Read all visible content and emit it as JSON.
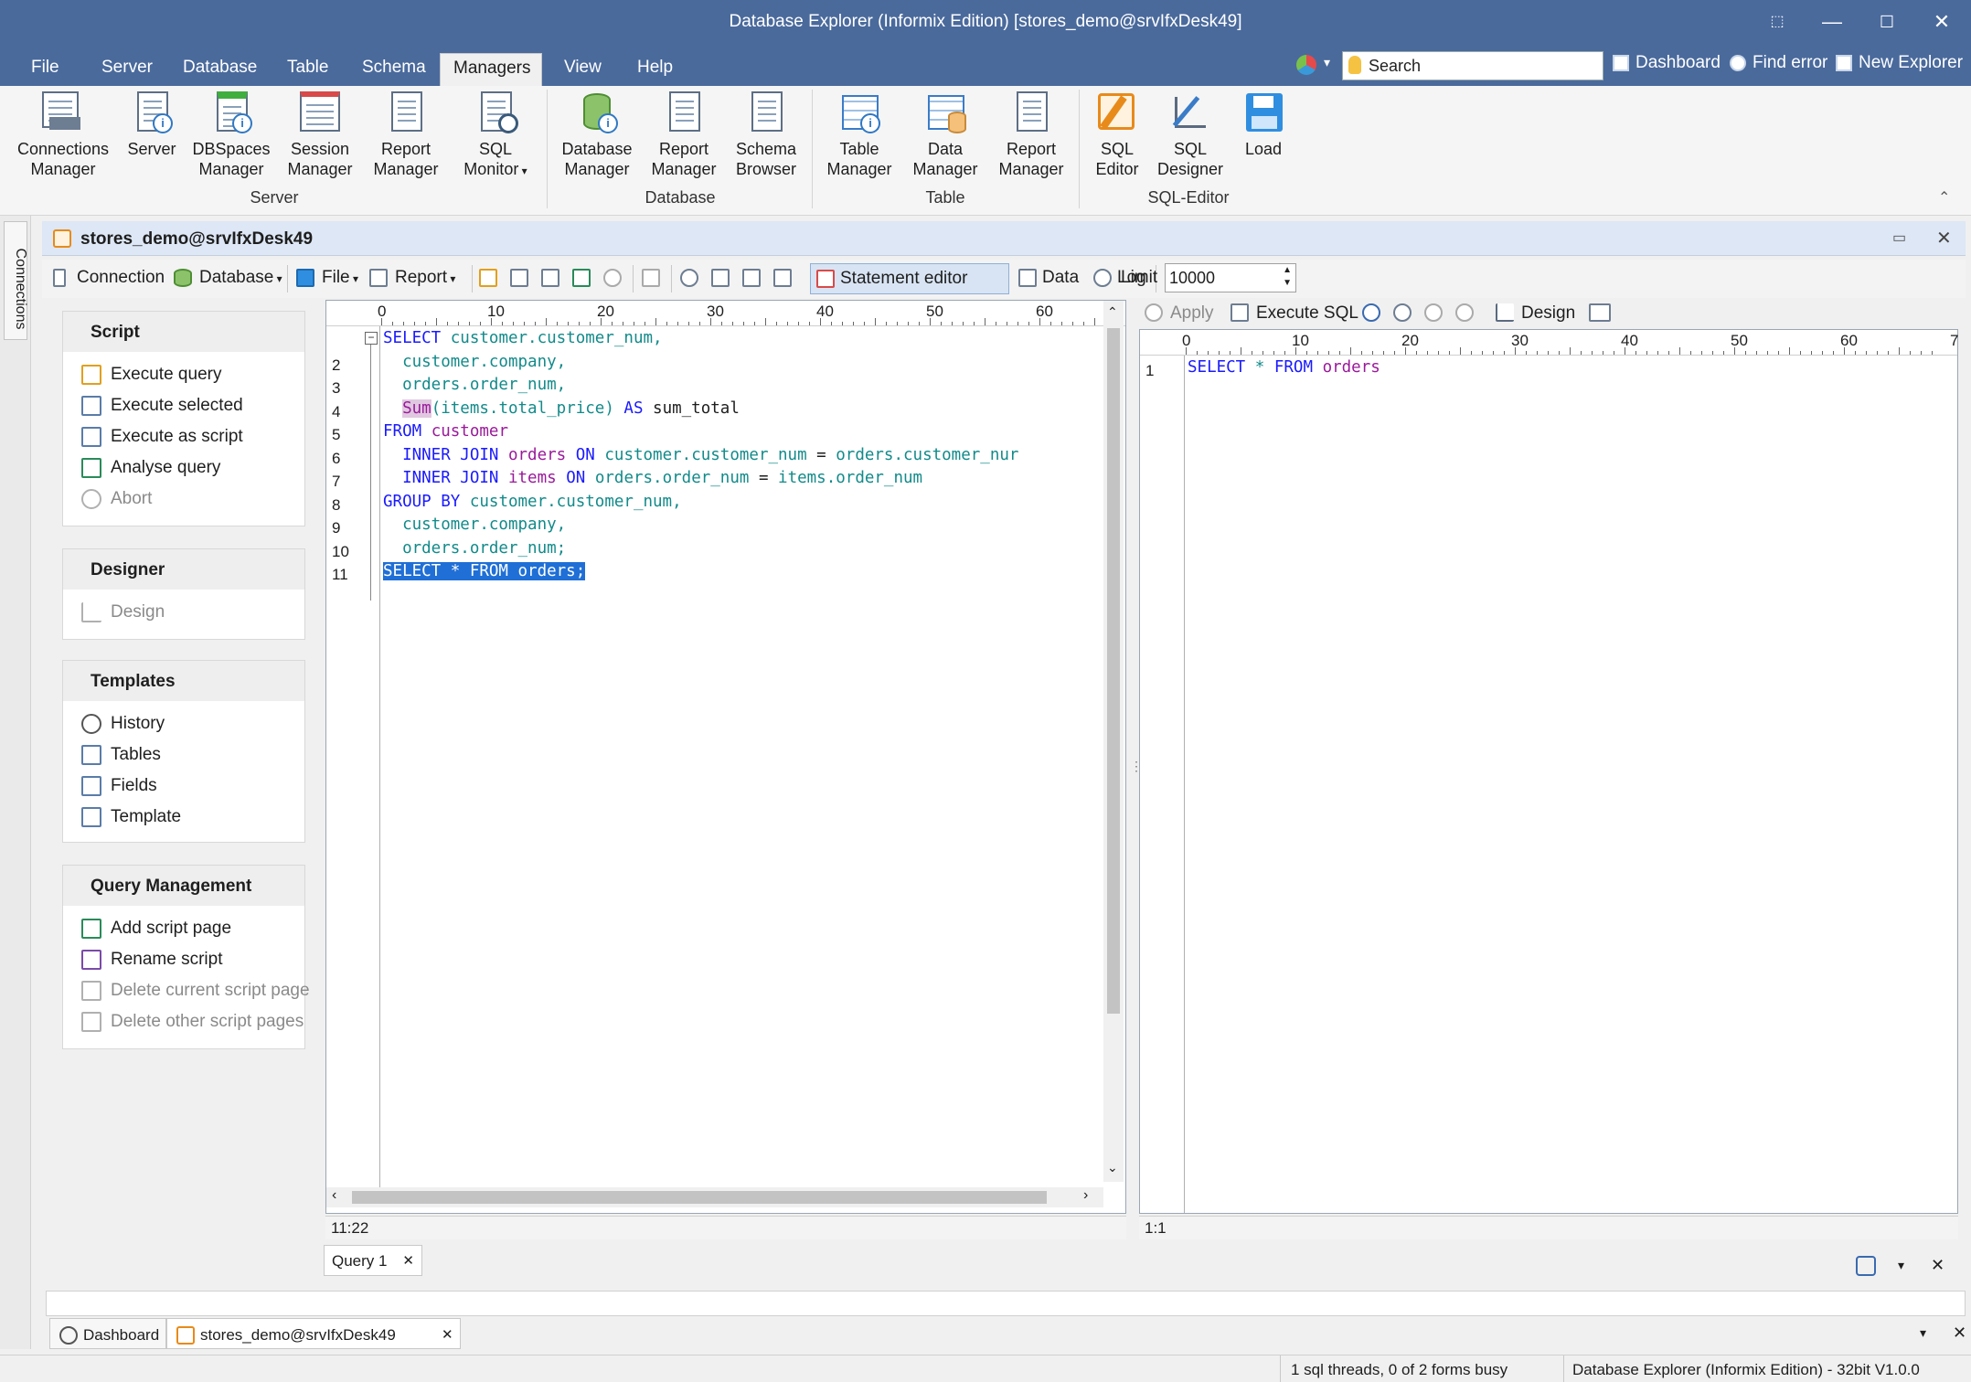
{
  "window": {
    "title": "Database Explorer (Informix Edition) [stores_demo@srvIfxDesk49]"
  },
  "menu": [
    "File",
    "Server",
    "Database",
    "Table",
    "Schema",
    "Managers",
    "View",
    "Help"
  ],
  "search": {
    "placeholder": "Search"
  },
  "quick_links": [
    "Dashboard",
    "Find error",
    "New Explorer"
  ],
  "ribbon": {
    "server": {
      "label": "Server",
      "items": [
        {
          "l1": "Connections",
          "l2": "Manager",
          "icon": "connections-manager-icon"
        },
        {
          "l1": "Server",
          "l2": "",
          "icon": "server-icon"
        },
        {
          "l1": "DBSpaces",
          "l2": "Manager",
          "icon": "dbspaces-manager-icon"
        },
        {
          "l1": "Session",
          "l2": "Manager",
          "icon": "session-manager-icon"
        },
        {
          "l1": "Report",
          "l2": "Manager",
          "icon": "report-manager-icon"
        },
        {
          "l1": "SQL",
          "l2": "Monitor",
          "icon": "sql-monitor-icon"
        }
      ]
    },
    "database": {
      "label": "Database",
      "items": [
        {
          "l1": "Database",
          "l2": "Manager",
          "icon": "database-manager-icon"
        },
        {
          "l1": "Report",
          "l2": "Manager",
          "icon": "report-manager-icon"
        },
        {
          "l1": "Schema",
          "l2": "Browser",
          "icon": "schema-browser-icon"
        }
      ]
    },
    "table": {
      "label": "Table",
      "items": [
        {
          "l1": "Table",
          "l2": "Manager",
          "icon": "table-manager-icon"
        },
        {
          "l1": "Data",
          "l2": "Manager",
          "icon": "data-manager-icon"
        },
        {
          "l1": "Report",
          "l2": "Manager",
          "icon": "report-manager-icon"
        }
      ]
    },
    "sqleditor": {
      "label": "SQL-Editor",
      "items": [
        {
          "l1": "SQL",
          "l2": "Editor",
          "icon": "sql-editor-icon"
        },
        {
          "l1": "SQL",
          "l2": "Designer",
          "icon": "sql-designer-icon"
        },
        {
          "l1": "Load",
          "l2": "",
          "icon": "load-icon"
        }
      ]
    }
  },
  "side_tab": "Connections",
  "document": {
    "title": "stores_demo@srvIfxDesk49"
  },
  "toolbar": {
    "connection": "Connection",
    "database": "Database",
    "file": "File",
    "report": "Report",
    "statement_editor": "Statement editor",
    "data": "Data",
    "log": "Log",
    "limit_label": "Limit",
    "limit_value": "10000"
  },
  "panels": {
    "script": {
      "title": "Script",
      "items": [
        {
          "label": "Execute query",
          "enabled": true
        },
        {
          "label": "Execute selected",
          "enabled": true
        },
        {
          "label": "Execute as script",
          "enabled": true
        },
        {
          "label": "Analyse query",
          "enabled": true
        },
        {
          "label": "Abort",
          "enabled": false
        }
      ]
    },
    "designer": {
      "title": "Designer",
      "items": [
        {
          "label": "Design",
          "enabled": false
        }
      ]
    },
    "templates": {
      "title": "Templates",
      "items": [
        {
          "label": "History",
          "enabled": true
        },
        {
          "label": "Tables",
          "enabled": true
        },
        {
          "label": "Fields",
          "enabled": true
        },
        {
          "label": "Template",
          "enabled": true
        }
      ]
    },
    "query_management": {
      "title": "Query Management",
      "items": [
        {
          "label": "Add script page",
          "enabled": true
        },
        {
          "label": "Rename script",
          "enabled": true
        },
        {
          "label": "Delete current script page",
          "enabled": false
        },
        {
          "label": "Delete other script pages",
          "enabled": false
        }
      ]
    }
  },
  "editor": {
    "ruler": [
      "0",
      "10",
      "20",
      "30",
      "40",
      "50",
      "60"
    ],
    "line_numbers": [
      "",
      "2",
      "3",
      "4",
      "5",
      "6",
      "7",
      "8",
      "9",
      "10",
      "11"
    ],
    "lines": [
      [
        [
          "kw",
          "SELECT"
        ],
        [
          "plain",
          " "
        ],
        [
          "fld",
          "customer.customer_num,"
        ]
      ],
      [
        [
          "plain",
          "  "
        ],
        [
          "fld",
          "customer.company,"
        ]
      ],
      [
        [
          "plain",
          "  "
        ],
        [
          "fld",
          "orders.order_num,"
        ]
      ],
      [
        [
          "plain",
          "  "
        ],
        [
          "fn",
          "Sum"
        ],
        [
          "fld",
          "(items.total_price)"
        ],
        [
          "plain",
          " "
        ],
        [
          "kw",
          "AS"
        ],
        [
          "plain",
          " sum_total"
        ]
      ],
      [
        [
          "kw",
          "FROM"
        ],
        [
          "plain",
          " "
        ],
        [
          "obj",
          "customer"
        ]
      ],
      [
        [
          "plain",
          "  "
        ],
        [
          "kw",
          "INNER JOIN"
        ],
        [
          "plain",
          " "
        ],
        [
          "obj",
          "orders"
        ],
        [
          "plain",
          " "
        ],
        [
          "kw",
          "ON"
        ],
        [
          "plain",
          " "
        ],
        [
          "fld",
          "customer.customer_num"
        ],
        [
          "plain",
          " = "
        ],
        [
          "fld",
          "orders.customer_nur"
        ]
      ],
      [
        [
          "plain",
          "  "
        ],
        [
          "kw",
          "INNER JOIN"
        ],
        [
          "plain",
          " "
        ],
        [
          "obj",
          "items"
        ],
        [
          "plain",
          " "
        ],
        [
          "kw",
          "ON"
        ],
        [
          "plain",
          " "
        ],
        [
          "fld",
          "orders.order_num"
        ],
        [
          "plain",
          " = "
        ],
        [
          "fld",
          "items.order_num"
        ]
      ],
      [
        [
          "kw",
          "GROUP BY"
        ],
        [
          "plain",
          " "
        ],
        [
          "fld",
          "customer.customer_num,"
        ]
      ],
      [
        [
          "plain",
          "  "
        ],
        [
          "fld",
          "customer.company,"
        ]
      ],
      [
        [
          "plain",
          "  "
        ],
        [
          "fld",
          "orders.order_num;"
        ]
      ],
      [
        [
          "sel",
          "SELECT * FROM orders;"
        ]
      ]
    ],
    "status": "11:22"
  },
  "stmt": {
    "toolbar": {
      "apply": "Apply",
      "execute_sql": "Execute SQL",
      "design": "Design"
    },
    "ruler": [
      "0",
      "10",
      "20",
      "30",
      "40",
      "50",
      "60",
      "7"
    ],
    "line_numbers": [
      "1"
    ],
    "lines": [
      [
        [
          "kw",
          "SELECT"
        ],
        [
          "plain",
          " "
        ],
        [
          "fld",
          "*"
        ],
        [
          "plain",
          " "
        ],
        [
          "kw",
          "FROM"
        ],
        [
          "plain",
          " "
        ],
        [
          "obj",
          "orders"
        ]
      ]
    ],
    "status": "1:1"
  },
  "query_tab": "Query 1",
  "window_tabs": [
    "Dashboard",
    "stores_demo@srvIfxDesk49"
  ],
  "statusbar": {
    "threads": "1 sql threads, 0 of 2 forms busy",
    "app": "Database Explorer (Informix Edition) - 32bit V1.0.0"
  }
}
